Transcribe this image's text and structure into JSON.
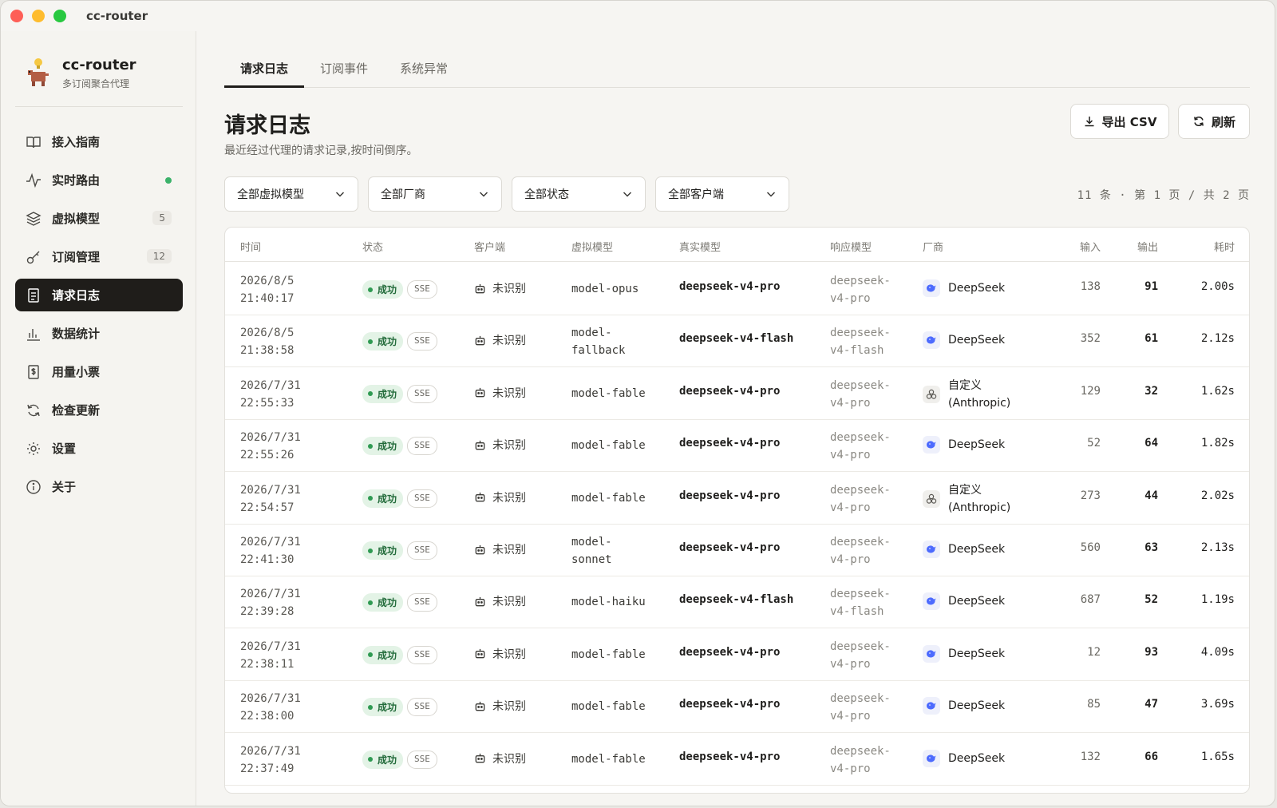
{
  "window": {
    "title": "cc-router"
  },
  "sidebar": {
    "brand_title": "cc-router",
    "brand_subtitle": "多订阅聚合代理",
    "items": [
      {
        "label": "接入指南",
        "icon": "book-icon"
      },
      {
        "label": "实时路由",
        "icon": "activity-icon",
        "dot_color": "#3bb26a"
      },
      {
        "label": "虚拟模型",
        "icon": "layers-icon",
        "badge": "5"
      },
      {
        "label": "订阅管理",
        "icon": "key-icon",
        "badge": "12"
      },
      {
        "label": "请求日志",
        "icon": "scroll-icon",
        "active": true
      },
      {
        "label": "数据统计",
        "icon": "bar-chart-icon"
      },
      {
        "label": "用量小票",
        "icon": "receipt-icon"
      },
      {
        "label": "检查更新",
        "icon": "refresh-icon"
      },
      {
        "label": "设置",
        "icon": "gear-icon"
      },
      {
        "label": "关于",
        "icon": "info-icon"
      }
    ]
  },
  "tabs": [
    {
      "label": "请求日志",
      "active": true
    },
    {
      "label": "订阅事件"
    },
    {
      "label": "系统异常"
    }
  ],
  "header": {
    "title": "请求日志",
    "subtitle": "最近经过代理的请求记录,按时间倒序。",
    "export_label": "导出 CSV",
    "refresh_label": "刷新"
  },
  "filters": [
    {
      "value": "全部虚拟模型"
    },
    {
      "value": "全部厂商"
    },
    {
      "value": "全部状态"
    },
    {
      "value": "全部客户端"
    }
  ],
  "pager": {
    "text": "11 条 · 第 1 页 / 共 2 页"
  },
  "table": {
    "columns": [
      "时间",
      "状态",
      "客户端",
      "虚拟模型",
      "真实模型",
      "响应模型",
      "厂商",
      "输入",
      "输出",
      "耗时"
    ],
    "rows": [
      {
        "date": "2026/8/5",
        "time": "21:40:17",
        "status": "成功",
        "mode": "SSE",
        "client": "未识别",
        "vmodel": [
          "model-opus"
        ],
        "rmodel": "deepseek-v4-pro",
        "resp": [
          "deepseek-",
          "v4-pro"
        ],
        "vendor": [
          "DeepSeek"
        ],
        "vendor_icon": "deepseek-whale-icon",
        "in": "138",
        "out": "91",
        "dur": "2.00s"
      },
      {
        "date": "2026/8/5",
        "time": "21:38:58",
        "status": "成功",
        "mode": "SSE",
        "client": "未识别",
        "vmodel": [
          "model-",
          "fallback"
        ],
        "rmodel": "deepseek-v4-flash",
        "resp": [
          "deepseek-",
          "v4-flash"
        ],
        "vendor": [
          "DeepSeek"
        ],
        "vendor_icon": "deepseek-whale-icon",
        "in": "352",
        "out": "61",
        "dur": "2.12s"
      },
      {
        "date": "2026/7/31",
        "time": "22:55:33",
        "status": "成功",
        "mode": "SSE",
        "client": "未识别",
        "vmodel": [
          "model-fable"
        ],
        "rmodel": "deepseek-v4-pro",
        "resp": [
          "deepseek-",
          "v4-pro"
        ],
        "vendor": [
          "自定义",
          "(Anthropic)"
        ],
        "vendor_icon": "custom-vendor-icon",
        "in": "129",
        "out": "32",
        "dur": "1.62s"
      },
      {
        "date": "2026/7/31",
        "time": "22:55:26",
        "status": "成功",
        "mode": "SSE",
        "client": "未识别",
        "vmodel": [
          "model-fable"
        ],
        "rmodel": "deepseek-v4-pro",
        "resp": [
          "deepseek-",
          "v4-pro"
        ],
        "vendor": [
          "DeepSeek"
        ],
        "vendor_icon": "deepseek-whale-icon",
        "in": "52",
        "out": "64",
        "dur": "1.82s"
      },
      {
        "date": "2026/7/31",
        "time": "22:54:57",
        "status": "成功",
        "mode": "SSE",
        "client": "未识别",
        "vmodel": [
          "model-fable"
        ],
        "rmodel": "deepseek-v4-pro",
        "resp": [
          "deepseek-",
          "v4-pro"
        ],
        "vendor": [
          "自定义",
          "(Anthropic)"
        ],
        "vendor_icon": "custom-vendor-icon",
        "in": "273",
        "out": "44",
        "dur": "2.02s"
      },
      {
        "date": "2026/7/31",
        "time": "22:41:30",
        "status": "成功",
        "mode": "SSE",
        "client": "未识别",
        "vmodel": [
          "model-",
          "sonnet"
        ],
        "rmodel": "deepseek-v4-pro",
        "resp": [
          "deepseek-",
          "v4-pro"
        ],
        "vendor": [
          "DeepSeek"
        ],
        "vendor_icon": "deepseek-whale-icon",
        "in": "560",
        "out": "63",
        "dur": "2.13s"
      },
      {
        "date": "2026/7/31",
        "time": "22:39:28",
        "status": "成功",
        "mode": "SSE",
        "client": "未识别",
        "vmodel": [
          "model-haiku"
        ],
        "rmodel": "deepseek-v4-flash",
        "resp": [
          "deepseek-",
          "v4-flash"
        ],
        "vendor": [
          "DeepSeek"
        ],
        "vendor_icon": "deepseek-whale-icon",
        "in": "687",
        "out": "52",
        "dur": "1.19s"
      },
      {
        "date": "2026/7/31",
        "time": "22:38:11",
        "status": "成功",
        "mode": "SSE",
        "client": "未识别",
        "vmodel": [
          "model-fable"
        ],
        "rmodel": "deepseek-v4-pro",
        "resp": [
          "deepseek-",
          "v4-pro"
        ],
        "vendor": [
          "DeepSeek"
        ],
        "vendor_icon": "deepseek-whale-icon",
        "in": "12",
        "out": "93",
        "dur": "4.09s"
      },
      {
        "date": "2026/7/31",
        "time": "22:38:00",
        "status": "成功",
        "mode": "SSE",
        "client": "未识别",
        "vmodel": [
          "model-fable"
        ],
        "rmodel": "deepseek-v4-pro",
        "resp": [
          "deepseek-",
          "v4-pro"
        ],
        "vendor": [
          "DeepSeek"
        ],
        "vendor_icon": "deepseek-whale-icon",
        "in": "85",
        "out": "47",
        "dur": "3.69s"
      },
      {
        "date": "2026/7/31",
        "time": "22:37:49",
        "status": "成功",
        "mode": "SSE",
        "client": "未识别",
        "vmodel": [
          "model-fable"
        ],
        "rmodel": "deepseek-v4-pro",
        "resp": [
          "deepseek-",
          "v4-pro"
        ],
        "vendor": [
          "DeepSeek"
        ],
        "vendor_icon": "deepseek-whale-icon",
        "in": "132",
        "out": "66",
        "dur": "1.65s"
      }
    ]
  },
  "colors": {
    "accent_dark": "#1f1d1a",
    "success_bg": "#e3f3e6",
    "success_text": "#226b3a",
    "live_dot": "#3bb26a",
    "deepseek_blue": "#4d6bfe"
  }
}
